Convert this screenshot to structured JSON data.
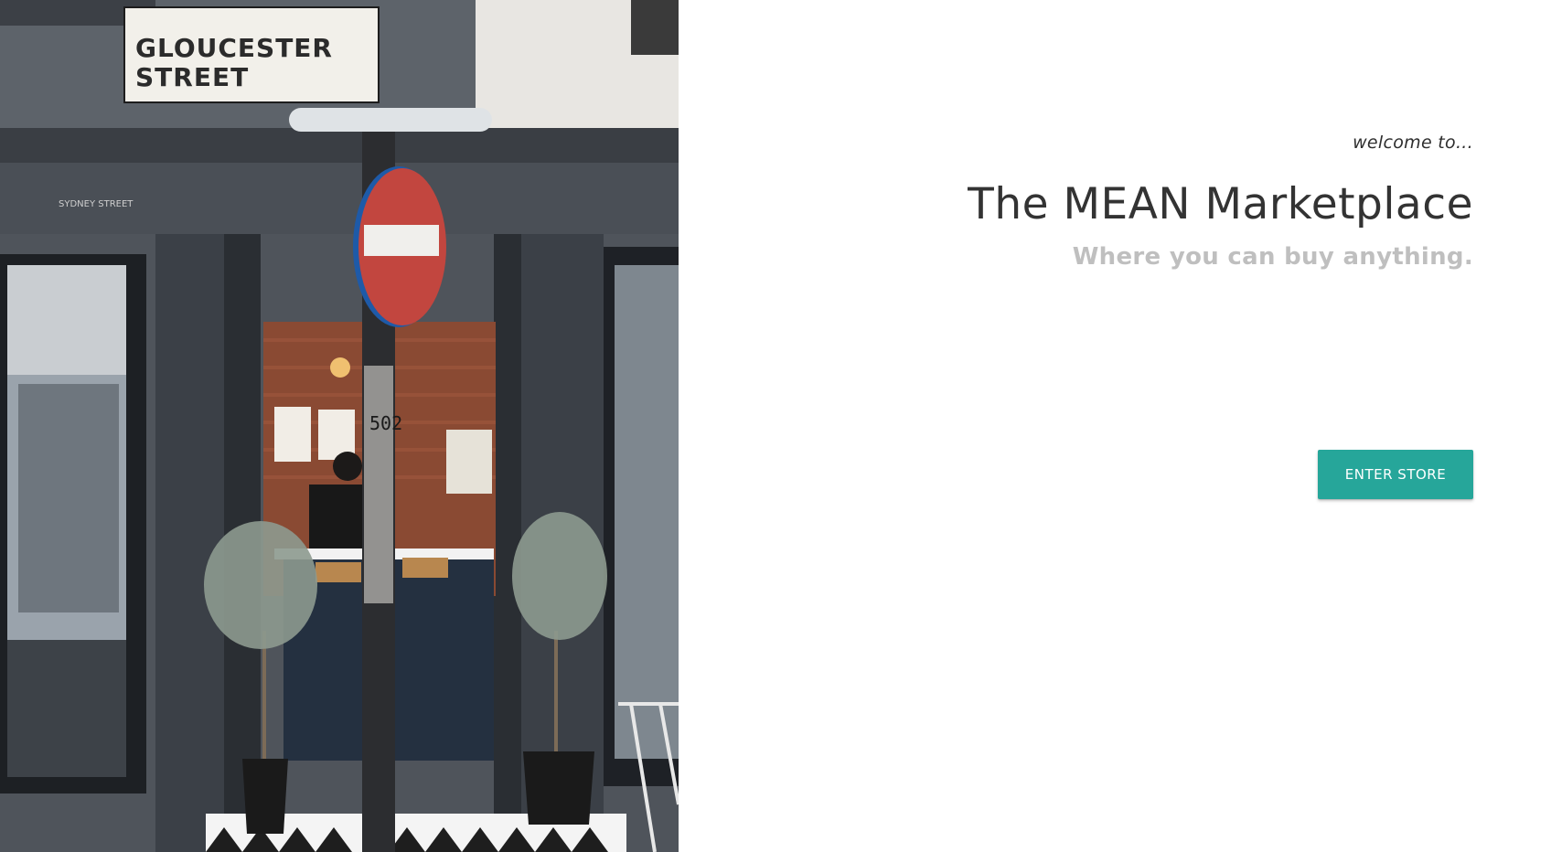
{
  "hero": {
    "street_sign_line1": "GLOUCESTER",
    "street_sign_line2": "STREET",
    "shop_sign": "SYDNEY STREET",
    "pole_number": "502"
  },
  "welcome_text": "welcome to...",
  "title": "The MEAN Marketplace",
  "subtitle": "Where you can buy anything.",
  "enter_button_label": "ENTER STORE",
  "colors": {
    "accent": "#26a69a",
    "title": "#333333",
    "subtitle": "#bfbfbf"
  }
}
